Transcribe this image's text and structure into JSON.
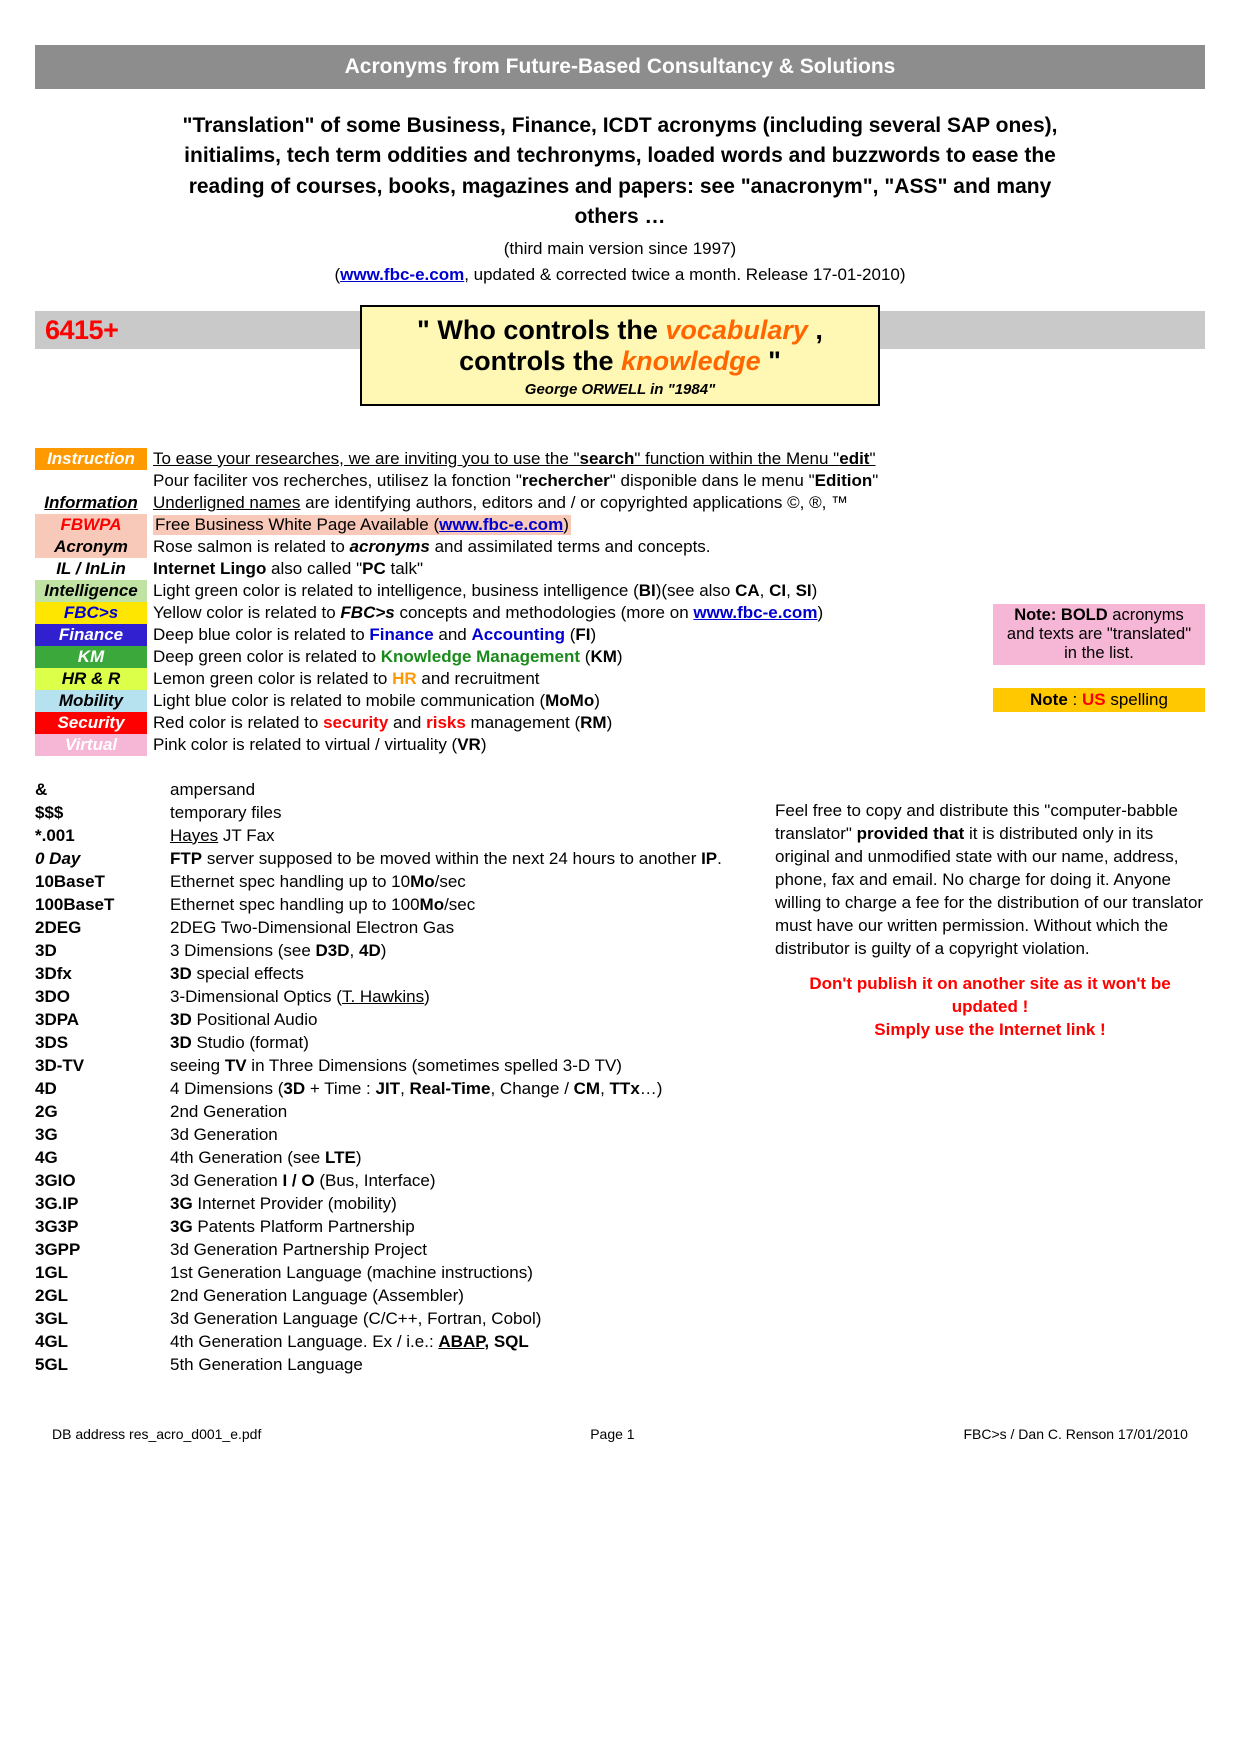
{
  "title": "Acronyms from Future-Based Consultancy & Solutions",
  "intro": "\"Translation\" of some Business, Finance, ICDT acronyms (including several SAP ones), initialims, tech term oddities and techronyms, loaded words and buzzwords to ease the reading of courses, books, magazines and papers: see \"anacronym\", \"ASS\" and many others …",
  "sub1": "(third main version since 1997)",
  "sub2_a": "(",
  "sub2_link": "www.fbc-e.com",
  "sub2_b": ", updated & corrected twice a month. Release 17-01-2010)",
  "count": "6415+",
  "quote_l1_a": "\" Who controls the ",
  "quote_l1_b": "vocabulary",
  "quote_l1_c": " ,",
  "quote_l2_a": "controls the ",
  "quote_l2_b": "knowledge",
  "quote_l2_c": " \"",
  "quote_attr": "George ORWELL in \"1984\"",
  "legend": {
    "instruction_key": "Instruction",
    "instruction_l1_a": "To ease your researches, we are inviting you to use the \"",
    "instruction_l1_b": "search",
    "instruction_l1_c": "\" function within the Menu \"",
    "instruction_l1_d": "edit",
    "instruction_l1_e": "\"",
    "instruction_l2_a": "Pour faciliter vos recherches, utilisez la fonction \"",
    "instruction_l2_b": "rechercher",
    "instruction_l2_c": "\" disponible dans le menu \"",
    "instruction_l2_d": "Edition",
    "instruction_l2_e": "\"",
    "information_key": "Information",
    "information_a": "Underligned names",
    "information_b": " are identifying authors, editors and / or copyrighted applications ©, ®, ™",
    "fbwpa_key": "FBWPA",
    "fbwpa_a": "Free Business White Page Available (",
    "fbwpa_link": "www.fbc-e.com",
    "fbwpa_b": ")",
    "acronym_key": "Acronym",
    "acronym_a": "Rose salmon is related to ",
    "acronym_b": "acronyms",
    "acronym_c": " and assimilated terms and concepts.",
    "il_key": "IL / InLin",
    "il_a": "Internet Lingo",
    "il_b": " also called \"",
    "il_c": "PC",
    "il_d": " talk\"",
    "intel_key": "Intelligence",
    "intel_a": "Light green color is related to intelligence, business intelligence (",
    "intel_b": "BI",
    "intel_c": ")(see also ",
    "intel_d": "CA",
    "intel_e": ", ",
    "intel_f": "CI",
    "intel_g": ", ",
    "intel_h": "SI",
    "intel_i": ")",
    "fbcs_key": "FBC>s",
    "fbcs_a": "Yellow color is related to ",
    "fbcs_b": "FBC>s",
    "fbcs_c": " concepts and methodologies (more on ",
    "fbcs_link": "www.fbc-e.com",
    "fbcs_d": ")",
    "fin_key": "Finance",
    "fin_a": "Deep blue color is related to ",
    "fin_b": "Finance",
    "fin_c": " and ",
    "fin_d": "Accounting",
    "fin_e": " (",
    "fin_f": "FI",
    "fin_g": ")",
    "km_key": "KM",
    "km_a": "Deep green color is related to ",
    "km_b": "Knowledge Management",
    "km_c": " (",
    "km_d": "KM",
    "km_e": ")",
    "hr_key": "HR & R",
    "hr_a": "Lemon green color is related to ",
    "hr_b": "HR",
    "hr_c": " and recruitment",
    "mob_key": "Mobility",
    "mob_a": "Light blue color is related to mobile communication (",
    "mob_b": "MoMo",
    "mob_c": ")",
    "sec_key": "Security",
    "sec_a": "Red color is related to ",
    "sec_b": "security",
    "sec_c": " and ",
    "sec_d": "risks",
    "sec_e": " management (",
    "sec_f": "RM",
    "sec_g": ")",
    "vir_key": "Virtual",
    "vir_a": "Pink color is related to virtual / virtuality (",
    "vir_b": "VR",
    "vir_c": ")"
  },
  "note_pink_l1a": "Note: BOLD",
  "note_pink_l1b": " acronyms",
  "note_pink_l2": "and texts are \"translated\"",
  "note_pink_l3": "in the list.",
  "note_gold_a": "Note",
  "note_gold_b": " : ",
  "note_gold_c": "US",
  "note_gold_d": " spelling",
  "disclaimer_a": "Feel free to copy and distribute this \"computer-babble translator\" ",
  "disclaimer_b": "provided that",
  "disclaimer_c": " it is distributed only in its original and unmodified state with our name, address, phone, fax and email. No charge for doing it. Anyone willing to charge a fee for the distribution of our translator must have our written permission. Without which the distributor is guilty of a copyright violation.",
  "warn1": "Don't publish it on another site as it won't be updated !",
  "warn2": "Simply use the Internet link !",
  "terms": [
    {
      "t": "&",
      "d": "ampersand"
    },
    {
      "t": "$$$",
      "d": "temporary files"
    },
    {
      "t": "*.001",
      "d": "<span class='u'>Hayes</span> JT Fax"
    },
    {
      "t": "0 Day",
      "italic": true,
      "d": "<b>FTP</b> server supposed to be moved within the next 24 hours to another <b>IP</b>."
    },
    {
      "t": "10BaseT",
      "d": "Ethernet spec handling up to 10<b>Mo</b>/sec"
    },
    {
      "t": "100BaseT",
      "d": "Ethernet spec handling up to 100<b>Mo</b>/sec"
    },
    {
      "t": "2DEG",
      "d": "2DEG Two-Dimensional Electron Gas"
    },
    {
      "t": "3D",
      "d": "3 Dimensions (see <b>D3D</b>, <b>4D</b>)"
    },
    {
      "t": "3Dfx",
      "d": "<b>3D</b> special effects"
    },
    {
      "t": "3DO",
      "d": "3-Dimensional Optics (<span class='u'>T. Hawkins</span>)"
    },
    {
      "t": "3DPA",
      "d": "<b>3D</b> Positional Audio"
    },
    {
      "t": "3DS",
      "d": "<b>3D</b> Studio (format)"
    },
    {
      "t": "3D-TV",
      "d": "seeing <b>TV</b> in Three Dimensions (sometimes spelled 3-D TV)"
    },
    {
      "t": "4D",
      "d": "4 Dimensions (<b>3D</b> + Time : <b>JIT</b>, <b>Real-Time</b>, Change / <b>CM</b>, <b>TTx</b>…)"
    },
    {
      "t": "2G",
      "d": "2nd Generation"
    },
    {
      "t": "3G",
      "d": "3d Generation"
    },
    {
      "t": "4G",
      "d": "4th Generation (see <b>LTE</b>)"
    },
    {
      "t": "3GIO",
      "d": "3d Generation <b>I / O</b> (Bus, Interface)"
    },
    {
      "t": "3G.IP",
      "d": "<b>3G</b> Internet Provider (mobility)"
    },
    {
      "t": "3G3P",
      "d": "<b>3G</b> Patents Platform Partnership"
    },
    {
      "t": "3GPP",
      "d": "3d Generation Partnership Project"
    },
    {
      "t": "1GL",
      "d": "1st Generation Language (machine instructions)"
    },
    {
      "t": "2GL",
      "d": "2nd Generation Language (Assembler)"
    },
    {
      "t": "3GL",
      "d": "3d Generation Language (C/C++, Fortran, Cobol)"
    },
    {
      "t": "4GL",
      "d": "4th Generation Language. Ex / i.e.: <b><span class='u'>ABAP</span>, SQL</b>"
    },
    {
      "t": "5GL",
      "d": "5th Generation Language"
    }
  ],
  "footer": {
    "left": "DB address res_acro_d001_e.pdf",
    "center": "Page 1",
    "right": "FBC>s / Dan C. Renson 17/01/2010"
  }
}
